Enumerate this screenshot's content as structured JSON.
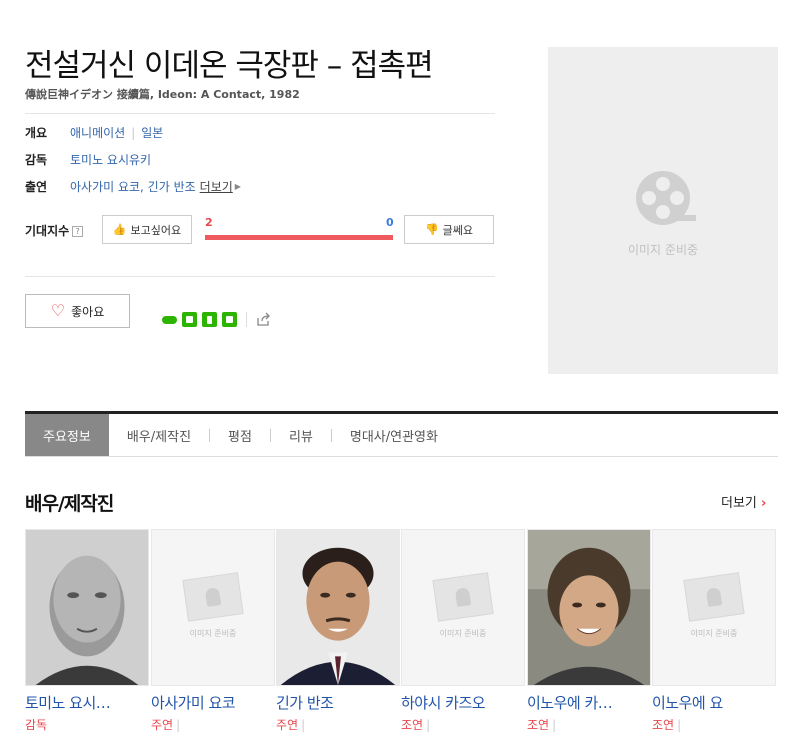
{
  "movie": {
    "title": "전설거신 이데온 극장판 – 접촉편",
    "subtitle": "傳說巨神イデオン 接續篇, Ideon: A Contact, 1982"
  },
  "info": {
    "overview_label": "개요",
    "genre": "애니메이션",
    "country": "일본",
    "director_label": "감독",
    "director": "토미노 요시유키",
    "cast_label": "출연",
    "cast_text": "아사가미 요코, 긴가 반조",
    "more": "더보기"
  },
  "expectation": {
    "label": "기대지수",
    "help": "?",
    "want_label": "보고싶어요",
    "nope_label": "글쎄요",
    "want_count": "2",
    "nope_count": "0",
    "want_ratio": 1.0
  },
  "like_button": {
    "label": "좋아요"
  },
  "share_icons": [
    "blog-icon",
    "band-icon",
    "bookmark-icon",
    "square-icon",
    "share-out-icon"
  ],
  "poster": {
    "placeholder": "이미지 준비중"
  },
  "tabs": [
    {
      "label": "주요정보",
      "active": true
    },
    {
      "label": "배우/제작진",
      "active": false
    },
    {
      "label": "평점",
      "active": false
    },
    {
      "label": "리뷰",
      "active": false
    },
    {
      "label": "명대사/연관영화",
      "active": false
    }
  ],
  "cast_section": {
    "title": "배우/제작진",
    "more": "더보기"
  },
  "cast": [
    {
      "name": "토미노 요시…",
      "role": "감독",
      "has_photo": true
    },
    {
      "name": "아사가미 요코",
      "role": "주연",
      "has_photo": false
    },
    {
      "name": "긴가 반조",
      "role": "주연",
      "has_photo": true
    },
    {
      "name": "하야시 카즈오",
      "role": "조연",
      "has_photo": false
    },
    {
      "name": "이노우에 카…",
      "role": "조연",
      "has_photo": true
    },
    {
      "name": "이노우에 요",
      "role": "조연",
      "has_photo": false
    }
  ],
  "placeholder_small": "이미지 준비중",
  "colors": {
    "accent_red": "#e8474c",
    "link_blue": "#3366aa",
    "share_green": "#2db400"
  }
}
